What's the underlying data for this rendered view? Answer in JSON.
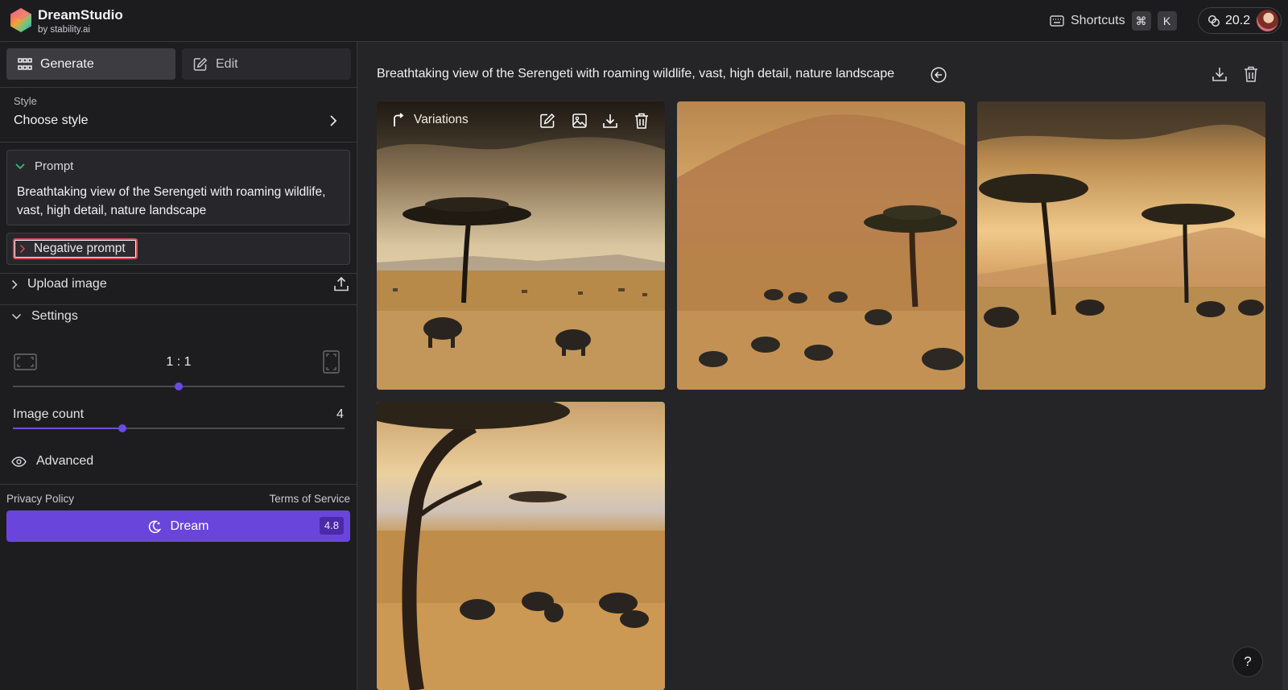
{
  "app": {
    "name": "DreamStudio",
    "by": "by stability.ai"
  },
  "topbar": {
    "shortcuts_label": "Shortcuts",
    "shortcut_keys": [
      "⌘",
      "K"
    ],
    "credits": "20.2"
  },
  "sidebar": {
    "tabs": [
      {
        "label": "Generate",
        "icon": "grid-icon",
        "active": true
      },
      {
        "label": "Edit",
        "icon": "edit-icon",
        "active": false
      }
    ],
    "style": {
      "label": "Style",
      "value": "Choose style"
    },
    "prompt": {
      "label": "Prompt",
      "text": "Breathtaking view of the Serengeti with roaming wildlife, vast, high detail, nature landscape"
    },
    "negative_prompt": {
      "label": "Negative prompt"
    },
    "upload_image": {
      "label": "Upload image"
    },
    "settings": {
      "label": "Settings",
      "aspect_ratio": "1 : 1",
      "aspect_ratio_position": 0.5,
      "image_count_label": "Image count",
      "image_count": "4",
      "image_count_position": 0.33
    },
    "advanced": {
      "label": "Advanced"
    },
    "footer": {
      "privacy": "Privacy Policy",
      "terms": "Terms of Service"
    },
    "dream_button": {
      "label": "Dream",
      "cost": "4.8"
    }
  },
  "main": {
    "title": "Breathtaking view of the Serengeti with roaming wildlife, vast, high detail, nature landscape",
    "images": [
      {
        "overlay": {
          "variations_label": "Variations"
        }
      },
      {},
      {},
      {}
    ]
  },
  "help_label": "?",
  "colors": {
    "accent": "#6a45dc",
    "background": "#252528",
    "sidebar": "#1d1d20"
  }
}
